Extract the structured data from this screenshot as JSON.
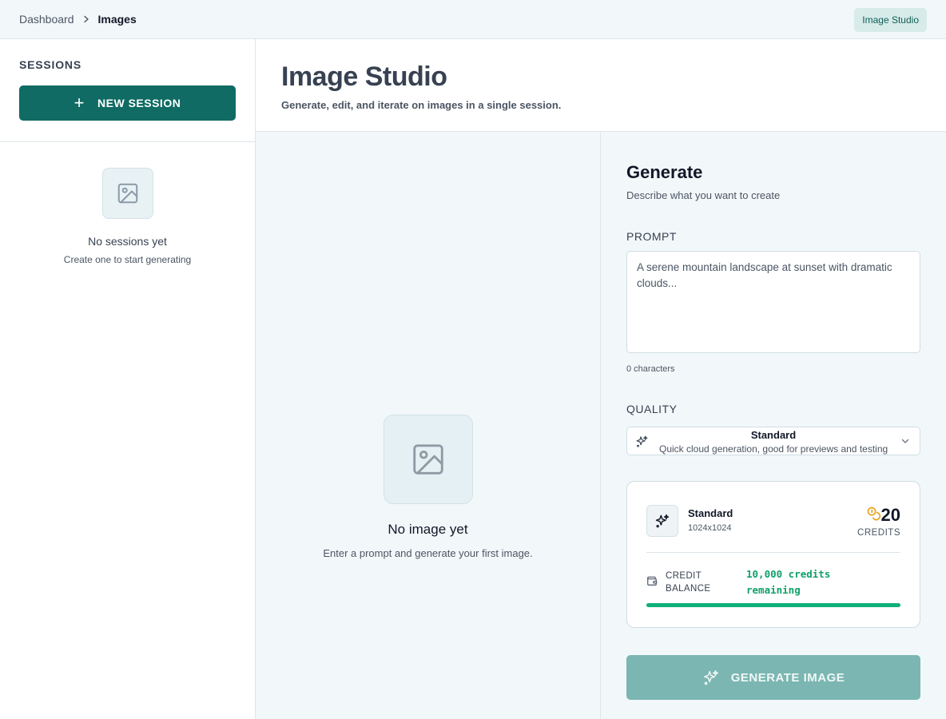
{
  "breadcrumb": {
    "parent": "Dashboard",
    "current": "Images"
  },
  "top_badge": "Image Studio",
  "sidebar": {
    "title": "SESSIONS",
    "new_session_label": "NEW SESSION",
    "empty_title": "No sessions yet",
    "empty_subtitle": "Create one to start generating"
  },
  "header": {
    "title": "Image Studio",
    "subtitle": "Generate, edit, and iterate on images in a single session."
  },
  "canvas": {
    "empty_title": "No image yet",
    "empty_subtitle": "Enter a prompt and generate your first image."
  },
  "generate_panel": {
    "title": "Generate",
    "subtitle": "Describe what you want to create",
    "prompt_label": "PROMPT",
    "prompt_placeholder": "A serene mountain landscape at sunset with dramatic clouds...",
    "prompt_value": "",
    "char_count": "0 characters",
    "quality_label": "QUALITY",
    "quality_selected": "Standard",
    "quality_description": "Quick cloud generation, good for previews and testing",
    "cost_card": {
      "tier_name": "Standard",
      "tier_size": "1024x1024",
      "credits_amount": "20",
      "credits_unit": "CREDITS",
      "balance_label": "CREDIT BALANCE",
      "balance_value": "10,000 credits remaining",
      "balance_progress": 1.0
    },
    "generate_button": "GENERATE IMAGE"
  },
  "colors": {
    "primary": "#0f6b63",
    "primary_disabled": "#7bb6b2",
    "success": "#10b079",
    "coin": "#e9a21a",
    "page_bg": "#f2f8fa"
  },
  "icons": [
    "chevron-right-icon",
    "plus-icon",
    "image-icon",
    "sparkles-icon",
    "chevron-down-icon",
    "coins-icon",
    "wallet-icon"
  ]
}
